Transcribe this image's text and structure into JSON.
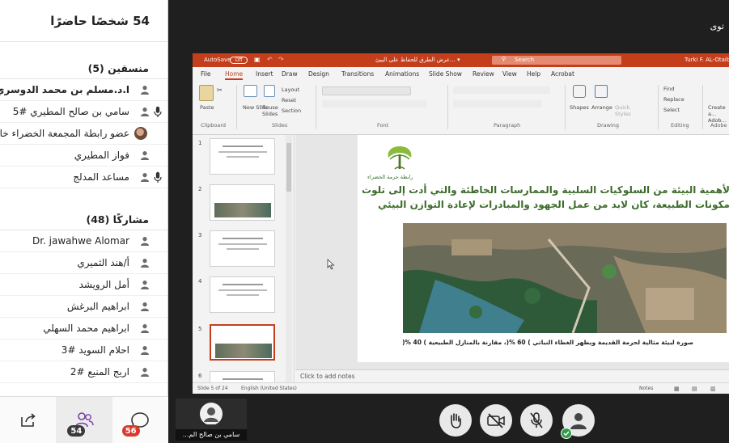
{
  "panel": {
    "title": "54 شخصًا حاضرًا",
    "coordinators_title": "منسقين (5)",
    "coordinators": [
      {
        "name": "ا.د.مسلم بن محمد الدوسري",
        "mic": false,
        "photo": false,
        "bold": true
      },
      {
        "name": "سامي بن صالح المطيري #5",
        "mic": true,
        "photo": false,
        "bold": false
      },
      {
        "name": "عضو رابطة المجمعة الخضراء خالد",
        "mic": false,
        "photo": true,
        "bold": false
      },
      {
        "name": "فواز المطيري",
        "mic": false,
        "photo": false,
        "bold": false
      },
      {
        "name": "مساعد المدلج",
        "mic": true,
        "photo": false,
        "bold": false
      }
    ],
    "participants_title": "مشاركًا (48)",
    "participants": [
      {
        "name": "Dr. jawahwe Alomar"
      },
      {
        "name": "أ/هند الثميري"
      },
      {
        "name": "أمل الرويشد"
      },
      {
        "name": "ابراهيم البرغش"
      },
      {
        "name": "ابراهيم محمد السهلي"
      },
      {
        "name": "احلام السويد #3"
      },
      {
        "name": "اريج المنيع #2"
      }
    ],
    "tabs": [
      {
        "icon": "share-icon",
        "badge": ""
      },
      {
        "icon": "people-icon",
        "badge": "54",
        "badge_color": "#3a3a3a"
      },
      {
        "icon": "chat-icon",
        "badge": "56",
        "badge_color": "#d93a2b"
      }
    ]
  },
  "meeting": {
    "title_partial": "توى"
  },
  "ppt": {
    "autosave": "AutoSave",
    "toggle": "Off",
    "doc_title": "عرض الطرق للحفاظ على البيئ... ▾",
    "search": "Search",
    "user": "Turki F. AL-Otaibi",
    "menu": [
      "File",
      "Home",
      "Insert",
      "Draw",
      "Design",
      "Transitions",
      "Animations",
      "Slide Show",
      "Review",
      "View",
      "Help",
      "Acrobat"
    ],
    "ribbon": {
      "paste": "Paste",
      "new_slide": "New Slide",
      "reuse": "Reuse Slides",
      "layout": "Layout",
      "reset": "Reset",
      "section": "Section",
      "shapes": "Shapes",
      "arrange": "Arrange",
      "quick_styles": "Quick Styles",
      "find": "Find",
      "replace": "Replace",
      "select": "Select",
      "create_adobe": "Create a... Adob...",
      "clipboard": "Clipboard",
      "slides": "Slides",
      "font": "Font",
      "paragraph": "Paragraph",
      "drawing": "Drawing",
      "editing": "Editing",
      "adobe": "Adobe"
    },
    "thumb_numbers": [
      "1",
      "2",
      "3",
      "4",
      "5",
      "6"
    ],
    "slide": {
      "logo_text": "رابطة حرمة الخضراء",
      "heading": "لأهمية البيئة من السلوكيات السلبية والممارسات الخاطئة والتي أدت إلى تلوث مكونات الطبيعة، كان لابد من عمل الجهود والمبادرات لإعادة التوازن البيئي",
      "caption": "صورة لبيئة مثالية لحرمة القديمة ويظهر الغطاء النباتي ) 60 %(، مقارنة بالمنازل الطبيعية ) 40 %("
    },
    "notes_placeholder": "Click to add notes",
    "status": {
      "slide_of": "Slide 5 of 24",
      "language": "English (United States)",
      "notes": "Notes"
    }
  },
  "self_view": {
    "name": "سامي بن صالح الم..."
  },
  "controls": [
    "raise-hand-icon",
    "video-off-icon",
    "mic-off-icon",
    "profile-icon"
  ]
}
